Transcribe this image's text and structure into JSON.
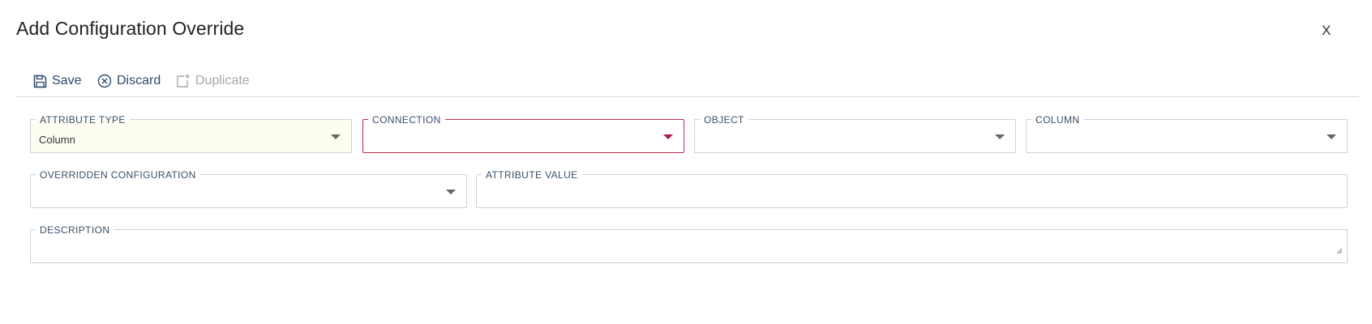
{
  "dialog": {
    "title": "Add Configuration Override",
    "close_label": "X"
  },
  "toolbar": {
    "save_label": "Save",
    "discard_label": "Discard",
    "duplicate_label": "Duplicate"
  },
  "form": {
    "attribute_type": {
      "label": "ATTRIBUTE TYPE",
      "value": "Column"
    },
    "connection": {
      "label": "CONNECTION",
      "value": ""
    },
    "object": {
      "label": "OBJECT",
      "value": ""
    },
    "column": {
      "label": "COLUMN",
      "value": ""
    },
    "overridden_configuration": {
      "label": "OVERRIDDEN CONFIGURATION",
      "value": ""
    },
    "attribute_value": {
      "label": "ATTRIBUTE VALUE",
      "value": ""
    },
    "description": {
      "label": "DESCRIPTION",
      "value": ""
    }
  },
  "icons": {
    "save": "floppy-disk-icon",
    "discard": "circle-x-icon",
    "duplicate": "duplicate-icon",
    "dropdown": "caret-down-icon"
  },
  "colors": {
    "label": "#3a5068",
    "toolbar": "#2c4a6b",
    "error_border": "#c0284a",
    "filled_background": "#fdfdf2",
    "disabled": "#a4a9ae"
  }
}
